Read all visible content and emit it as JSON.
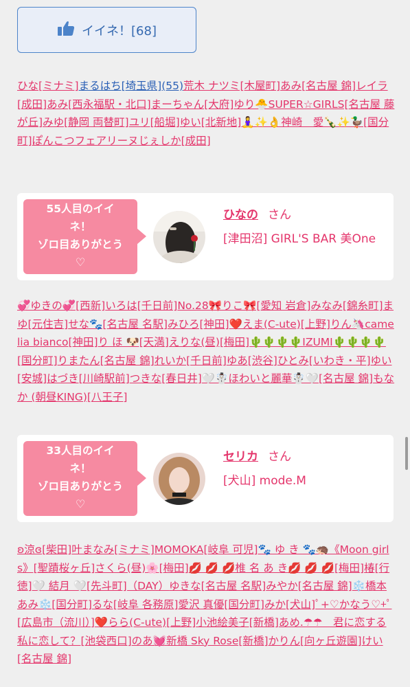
{
  "like_button": {
    "label": "イイネ！[68]"
  },
  "names_block_1": [
    "ひな[ミナミ]",
    {
      "text": "まるはち[埼玉県](55)",
      "link": true
    },
    "荒木 ナツミ[木屋町]",
    "あみ[名古屋 錦]",
    "レイラ[成田]",
    "あみ[西永福駅・北口]",
    "まーちゃん[大府]",
    "ゆり🐣SUPER☆GIRLS[名古屋 藤が丘]",
    "みゆ[静岡 両替町]",
    "ユリ[船堀]",
    "ゆい[北新地]",
    "🧘‍♀️✨👌神崎　愛🍾✨🦆[国分町]",
    "ぽんこつフェアリーヌじぇしか[成田]"
  ],
  "card_1": {
    "bubble_lines": [
      "55人目のイイ",
      "ネ！",
      "ゾロ目ありがとう",
      "♡"
    ],
    "cast_name": "ひなの",
    "honorific": "さん",
    "shop": "[津田沼] GIRL'S BAR 美One"
  },
  "names_block_2": [
    "💞ゆきの💞[西新]",
    "いろは[千日前]",
    "No.28🎀りこ🎀[愛知 岩倉]",
    "みなみ[錦糸町]",
    "まゆ[元住吉]",
    "せな🐾[名古屋 名駅]",
    "みひろ[神田]",
    "❤️えま(C-ute)[上野]",
    "りん🦄camelia bianco[神田]",
    "り ほ 🐶[天満]",
    "えりな(昼)[梅田]",
    "🌵🌵🌵🌵IZUMI🌵🌵🌵🌵[国分町]",
    "りまたん[名古屋 錦]",
    "れいか[千日前]",
    "ゆあ[渋谷]",
    "ひとみ[いわき・平]",
    "ゆい[安城]",
    "はづき[川崎駅前]",
    "つきな[春日井]",
    "🤍☃️ほわいと麗華☃️🤍[名古屋 錦]",
    "もなか (朝昼KING)[八王子]"
  ],
  "card_2": {
    "bubble_lines": [
      "33人目のイイ",
      "ネ！",
      "ゾロ目ありがとう",
      "♡"
    ],
    "cast_name": "セリカ",
    "honorific": "さん",
    "shop": "[犬山] mode.M"
  },
  "names_block_3": [
    "ʚ涼ɞ[柴田]",
    "叶まなみ[ミナミ]",
    "MOMOKA[岐阜 可児]",
    "🐾 ゆ き 🐾🦔《Moon girls》[聖蹟桜ヶ丘]",
    "さくら(昼)🌸[梅田]",
    "💋 💋 💋椎 名 あ き💋 💋 💋[梅田]",
    "椿[行徳]",
    "🤍 結月 🤍[先斗町]（DAY）",
    "ゆきな[名古屋 名駅]",
    "みやか[名古屋 錦]",
    "❄️橋本 あみ❄️[国分町]",
    "るな[岐阜 各務原]",
    "愛沢 真優[国分町]",
    "みか[犬山]",
    "ﾟ+♡かなう♡+ﾟ[広島市（流川）]",
    "❤️らら(C-ute)[上野]",
    "小池絵美子[新橋]",
    "あめ.☂︎☂︎　君に恋する私に恋して？[池袋西口]",
    "のあ💓新橋 Sky Rose[新橋]",
    "かりん[向ヶ丘遊園]",
    "けい[名古屋 錦]"
  ],
  "colors": {
    "background": "#efefef",
    "accent_pink": "#e4356b",
    "bubble_pink": "#f68aa1",
    "button_blue": "#3569b0",
    "link_blue": "#2a5fb5"
  },
  "icons": {
    "like": "thumbs-up-icon"
  }
}
